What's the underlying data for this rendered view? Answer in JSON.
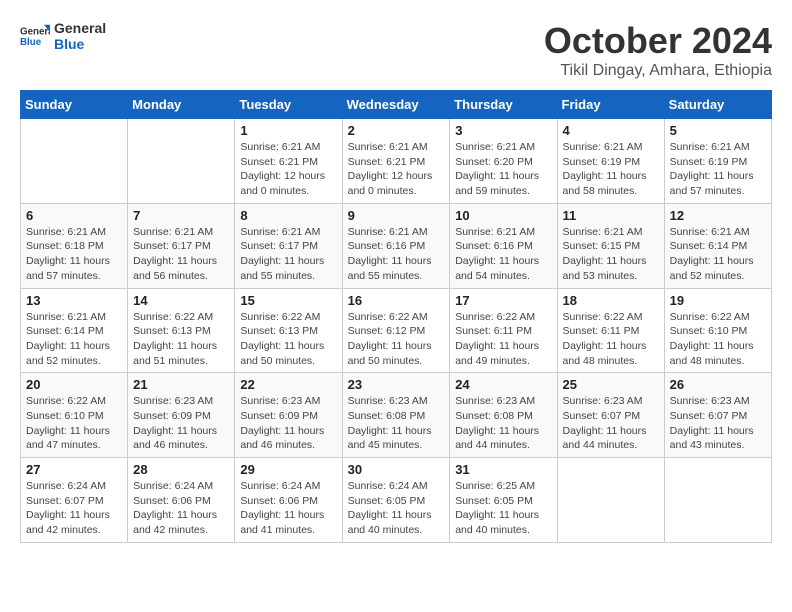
{
  "logo": {
    "text_general": "General",
    "text_blue": "Blue"
  },
  "title": {
    "month": "October 2024",
    "location": "Tikil Dingay, Amhara, Ethiopia"
  },
  "headers": [
    "Sunday",
    "Monday",
    "Tuesday",
    "Wednesday",
    "Thursday",
    "Friday",
    "Saturday"
  ],
  "weeks": [
    [
      {
        "day": "",
        "info": ""
      },
      {
        "day": "",
        "info": ""
      },
      {
        "day": "1",
        "info": "Sunrise: 6:21 AM\nSunset: 6:21 PM\nDaylight: 12 hours\nand 0 minutes."
      },
      {
        "day": "2",
        "info": "Sunrise: 6:21 AM\nSunset: 6:21 PM\nDaylight: 12 hours\nand 0 minutes."
      },
      {
        "day": "3",
        "info": "Sunrise: 6:21 AM\nSunset: 6:20 PM\nDaylight: 11 hours\nand 59 minutes."
      },
      {
        "day": "4",
        "info": "Sunrise: 6:21 AM\nSunset: 6:19 PM\nDaylight: 11 hours\nand 58 minutes."
      },
      {
        "day": "5",
        "info": "Sunrise: 6:21 AM\nSunset: 6:19 PM\nDaylight: 11 hours\nand 57 minutes."
      }
    ],
    [
      {
        "day": "6",
        "info": "Sunrise: 6:21 AM\nSunset: 6:18 PM\nDaylight: 11 hours\nand 57 minutes."
      },
      {
        "day": "7",
        "info": "Sunrise: 6:21 AM\nSunset: 6:17 PM\nDaylight: 11 hours\nand 56 minutes."
      },
      {
        "day": "8",
        "info": "Sunrise: 6:21 AM\nSunset: 6:17 PM\nDaylight: 11 hours\nand 55 minutes."
      },
      {
        "day": "9",
        "info": "Sunrise: 6:21 AM\nSunset: 6:16 PM\nDaylight: 11 hours\nand 55 minutes."
      },
      {
        "day": "10",
        "info": "Sunrise: 6:21 AM\nSunset: 6:16 PM\nDaylight: 11 hours\nand 54 minutes."
      },
      {
        "day": "11",
        "info": "Sunrise: 6:21 AM\nSunset: 6:15 PM\nDaylight: 11 hours\nand 53 minutes."
      },
      {
        "day": "12",
        "info": "Sunrise: 6:21 AM\nSunset: 6:14 PM\nDaylight: 11 hours\nand 52 minutes."
      }
    ],
    [
      {
        "day": "13",
        "info": "Sunrise: 6:21 AM\nSunset: 6:14 PM\nDaylight: 11 hours\nand 52 minutes."
      },
      {
        "day": "14",
        "info": "Sunrise: 6:22 AM\nSunset: 6:13 PM\nDaylight: 11 hours\nand 51 minutes."
      },
      {
        "day": "15",
        "info": "Sunrise: 6:22 AM\nSunset: 6:13 PM\nDaylight: 11 hours\nand 50 minutes."
      },
      {
        "day": "16",
        "info": "Sunrise: 6:22 AM\nSunset: 6:12 PM\nDaylight: 11 hours\nand 50 minutes."
      },
      {
        "day": "17",
        "info": "Sunrise: 6:22 AM\nSunset: 6:11 PM\nDaylight: 11 hours\nand 49 minutes."
      },
      {
        "day": "18",
        "info": "Sunrise: 6:22 AM\nSunset: 6:11 PM\nDaylight: 11 hours\nand 48 minutes."
      },
      {
        "day": "19",
        "info": "Sunrise: 6:22 AM\nSunset: 6:10 PM\nDaylight: 11 hours\nand 48 minutes."
      }
    ],
    [
      {
        "day": "20",
        "info": "Sunrise: 6:22 AM\nSunset: 6:10 PM\nDaylight: 11 hours\nand 47 minutes."
      },
      {
        "day": "21",
        "info": "Sunrise: 6:23 AM\nSunset: 6:09 PM\nDaylight: 11 hours\nand 46 minutes."
      },
      {
        "day": "22",
        "info": "Sunrise: 6:23 AM\nSunset: 6:09 PM\nDaylight: 11 hours\nand 46 minutes."
      },
      {
        "day": "23",
        "info": "Sunrise: 6:23 AM\nSunset: 6:08 PM\nDaylight: 11 hours\nand 45 minutes."
      },
      {
        "day": "24",
        "info": "Sunrise: 6:23 AM\nSunset: 6:08 PM\nDaylight: 11 hours\nand 44 minutes."
      },
      {
        "day": "25",
        "info": "Sunrise: 6:23 AM\nSunset: 6:07 PM\nDaylight: 11 hours\nand 44 minutes."
      },
      {
        "day": "26",
        "info": "Sunrise: 6:23 AM\nSunset: 6:07 PM\nDaylight: 11 hours\nand 43 minutes."
      }
    ],
    [
      {
        "day": "27",
        "info": "Sunrise: 6:24 AM\nSunset: 6:07 PM\nDaylight: 11 hours\nand 42 minutes."
      },
      {
        "day": "28",
        "info": "Sunrise: 6:24 AM\nSunset: 6:06 PM\nDaylight: 11 hours\nand 42 minutes."
      },
      {
        "day": "29",
        "info": "Sunrise: 6:24 AM\nSunset: 6:06 PM\nDaylight: 11 hours\nand 41 minutes."
      },
      {
        "day": "30",
        "info": "Sunrise: 6:24 AM\nSunset: 6:05 PM\nDaylight: 11 hours\nand 40 minutes."
      },
      {
        "day": "31",
        "info": "Sunrise: 6:25 AM\nSunset: 6:05 PM\nDaylight: 11 hours\nand 40 minutes."
      },
      {
        "day": "",
        "info": ""
      },
      {
        "day": "",
        "info": ""
      }
    ]
  ]
}
